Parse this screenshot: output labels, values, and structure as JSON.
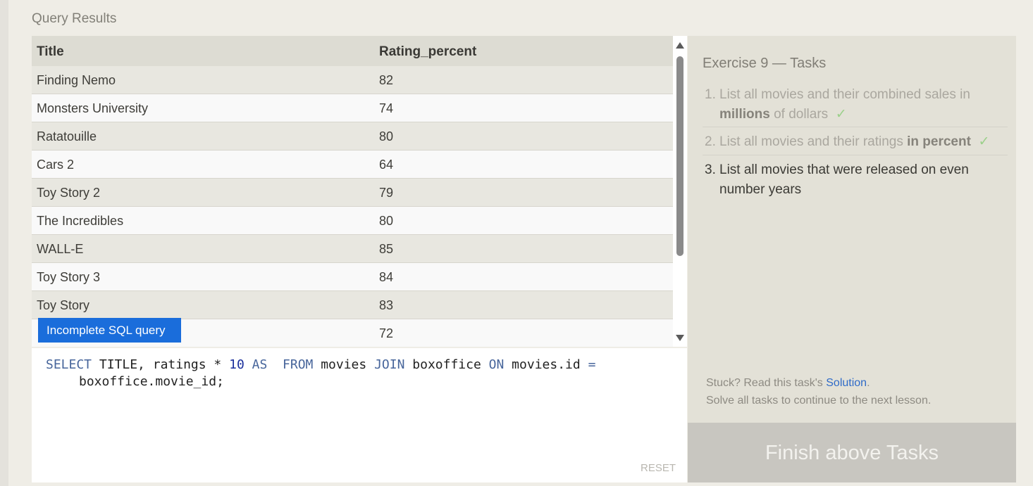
{
  "section_title": "Query Results",
  "table": {
    "columns": [
      "Title",
      "Rating_percent"
    ],
    "rows": [
      [
        "Finding Nemo",
        "82"
      ],
      [
        "Monsters University",
        "74"
      ],
      [
        "Ratatouille",
        "80"
      ],
      [
        "Cars 2",
        "64"
      ],
      [
        "Toy Story 2",
        "79"
      ],
      [
        "The Incredibles",
        "80"
      ],
      [
        "WALL-E",
        "85"
      ],
      [
        "Toy Story 3",
        "84"
      ],
      [
        "Toy Story",
        "83"
      ],
      [
        "",
        "72"
      ]
    ]
  },
  "badge": "Incomplete SQL query",
  "editor": {
    "line1": {
      "kw_select": "SELECT",
      "t1": " TITLE, ratings * ",
      "num": "10",
      "t2": " ",
      "kw_as": "AS",
      "t3": "  ",
      "kw_from": "FROM",
      "t4": " movies ",
      "kw_join": "JOIN",
      "t5": " boxoffice ",
      "kw_on": "ON",
      "t6": " movies.id ",
      "op": "="
    },
    "line2": "boxoffice.movie_id;",
    "reset_label": "RESET"
  },
  "tasks": {
    "title": "Exercise 9 — Tasks",
    "items": [
      {
        "number": "1.",
        "text_a": "List all movies and their combined sales in ",
        "bold": "millions",
        "text_b": " of dollars",
        "check": "✓",
        "done": true
      },
      {
        "number": "2.",
        "text_a": "List all movies and their ratings ",
        "bold": "in percent",
        "text_b": "",
        "check": "✓",
        "done": true
      },
      {
        "number": "3.",
        "text_a": "List all movies that were released on even number years",
        "done": false
      }
    ],
    "stuck_prefix": "Stuck? Read this task's ",
    "solution_link": "Solution",
    "stuck_suffix": ".",
    "continue_note": "Solve all tasks to continue to the next lesson.",
    "finish_button": "Finish above Tasks"
  },
  "colors": {
    "badge": "#1a6ddb",
    "keyword": "#47659b",
    "number": "#1b2f9c",
    "check": "#9bd08a",
    "link": "#2f6bc8"
  }
}
